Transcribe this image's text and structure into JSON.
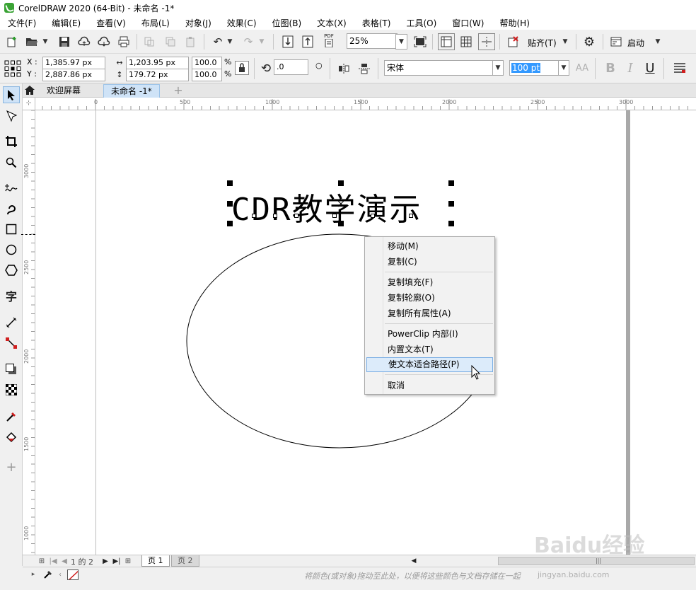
{
  "window": {
    "title": "CorelDRAW 2020 (64-Bit) - 未命名 -1*"
  },
  "menu": [
    "文件(F)",
    "编辑(E)",
    "查看(V)",
    "布局(L)",
    "对象(J)",
    "效果(C)",
    "位图(B)",
    "文本(X)",
    "表格(T)",
    "工具(O)",
    "窗口(W)",
    "帮助(H)"
  ],
  "toolbar": {
    "zoom_value": "25%",
    "snap_label": "贴齐(T)",
    "launch_label": "启动",
    "pdf_label": "PDF"
  },
  "property_bar": {
    "x_label": "X :",
    "y_label": "Y :",
    "x_value": "1,385.97 px",
    "y_value": "2,887.86 px",
    "width_value": "1,203.95 px",
    "height_value": "179.72 px",
    "scale_x": "100.0",
    "scale_y": "100.0",
    "percent": "%",
    "rotation": ".0",
    "font_name": "宋体",
    "font_size": "100 pt"
  },
  "doc_tabs": [
    {
      "label": "欢迎屏幕"
    },
    {
      "label": "未命名 -1*"
    }
  ],
  "rulers": {
    "h_ticks": [
      "0",
      "500",
      "1000",
      "1500",
      "2000",
      "2500",
      "3000"
    ],
    "v_ticks": [
      "3000",
      "2500",
      "2000",
      "1500",
      "1000"
    ]
  },
  "canvas": {
    "art_text": "CDR教学演示"
  },
  "context_menu": {
    "items": [
      {
        "label": "移动(M)"
      },
      {
        "label": "复制(C)"
      },
      {
        "label": "复制填充(F)"
      },
      {
        "label": "复制轮廓(O)"
      },
      {
        "label": "复制所有属性(A)"
      },
      {
        "label": "PowerClip 内部(I)"
      },
      {
        "label": "内置文本(T)"
      },
      {
        "label": "使文本适合路径(P)"
      },
      {
        "label": "取消"
      }
    ]
  },
  "page_nav": {
    "current_of_total": "1 的 2",
    "pages": [
      "页 1",
      "页 2"
    ]
  },
  "status": {
    "hint": "将颜色(或对象)拖动至此处，以便将这些颜色与文档存储在一起"
  },
  "watermark": {
    "brand": "Baidu经验",
    "url": "jingyan.baidu.com"
  },
  "colors": {
    "accent": "#3aa335",
    "highlight": "#dcebfa",
    "canvas": "#ffffff"
  }
}
